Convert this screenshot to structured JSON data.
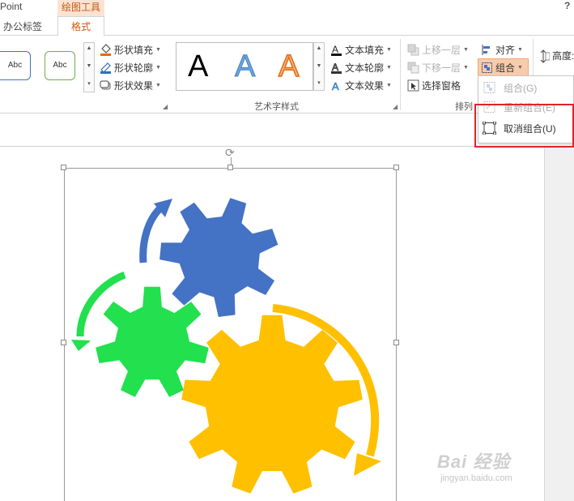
{
  "app": {
    "title": "Point",
    "help": "?"
  },
  "tabs": {
    "contextual_group": "绘图工具",
    "office_tab": "办公标签",
    "format_tab": "格式"
  },
  "shape_styles": {
    "samples": [
      "Abc",
      "Abc"
    ],
    "commands": [
      {
        "label": "形状填充",
        "icon": "paint-bucket-icon"
      },
      {
        "label": "形状轮廓",
        "icon": "pencil-outline-icon"
      },
      {
        "label": "形状效果",
        "icon": "shape-effect-icon"
      }
    ]
  },
  "wordart": {
    "samples": [
      "A",
      "A",
      "A"
    ],
    "commands": [
      {
        "label": "文本填充",
        "icon": "text-fill-icon"
      },
      {
        "label": "文本轮廓",
        "icon": "text-outline-icon"
      },
      {
        "label": "文本效果",
        "icon": "text-effect-icon"
      }
    ],
    "group_label": "艺术字样式"
  },
  "arrange": {
    "bring_forward": "上移一层",
    "send_backward": "下移一层",
    "selection_pane": "选择窗格",
    "align": "对齐",
    "group": "组合",
    "group_label_partial": "排列",
    "height_label": "高度:"
  },
  "group_menu": {
    "items": [
      {
        "label": "组合(G)",
        "enabled": false,
        "icon": "group-icon"
      },
      {
        "label": "重新组合(E)",
        "enabled": false,
        "icon": "regroup-icon"
      },
      {
        "label": "取消组合(U)",
        "enabled": true,
        "icon": "ungroup-icon"
      }
    ]
  },
  "canvas": {
    "gear_colors": {
      "blue": "#4472c4",
      "green": "#22e04e",
      "yellow": "#ffc000"
    }
  },
  "watermark": {
    "main": "Bai 经验",
    "sub": "jingyan.baidu.com"
  },
  "colors": {
    "accent": "#c55a11",
    "highlight": "#e0232b",
    "context_tab_bg": "#fbe3d3"
  }
}
